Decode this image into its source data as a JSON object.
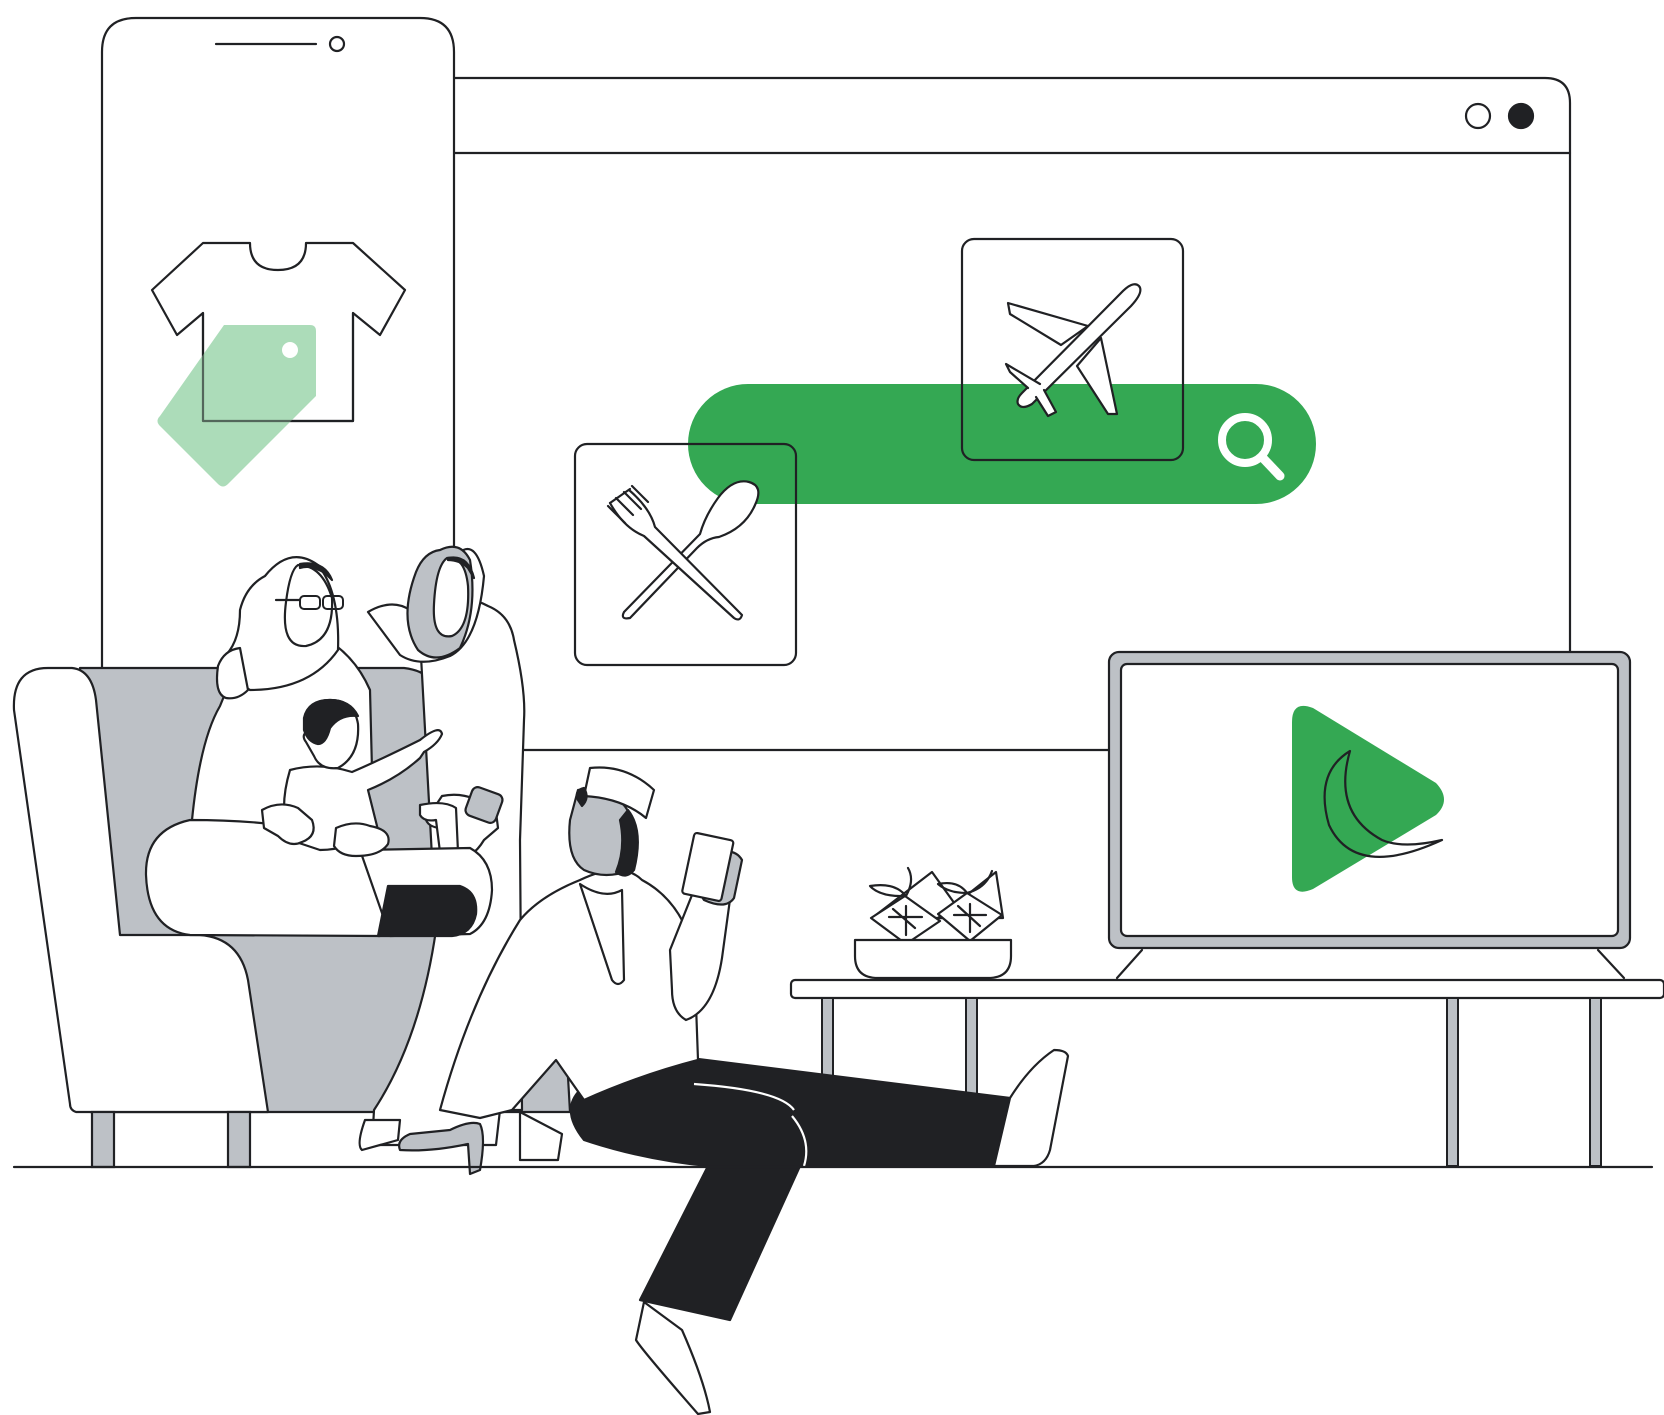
{
  "palette": {
    "ink": "#202124",
    "accent_green": "#34a853",
    "tag_green": "#a8dab5",
    "sofa_gray": "#bdc1c6",
    "background": "#ffffff"
  },
  "icons": {
    "phone": "smartphone-icon",
    "browser": "browser-window-icon",
    "search": "search-icon",
    "shirt": "t-shirt-icon",
    "price_tag": "price-tag-icon",
    "plane": "airplane-icon",
    "dining": "fork-and-spoon-icon",
    "play": "play-icon",
    "crescent": "crescent-moon-icon"
  },
  "browser": {
    "controls": [
      "window-dot-outline",
      "window-dot-filled"
    ]
  },
  "search_bar": {
    "value": ""
  }
}
